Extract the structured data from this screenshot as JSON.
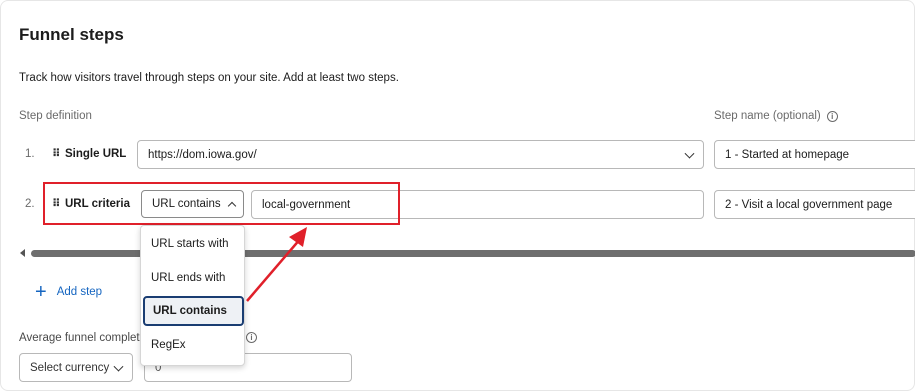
{
  "header": {
    "title": "Funnel steps",
    "description": "Track how visitors travel through steps on your site. Add at least two steps."
  },
  "columns": {
    "step_definition": "Step definition",
    "step_name": "Step name (optional)",
    "info_glyph": "i"
  },
  "rows": [
    {
      "number": "1.",
      "type": "Single URL",
      "url_value": "https://dom.iowa.gov/",
      "name_value": "1 - Started at homepage"
    },
    {
      "number": "2.",
      "type": "URL criteria",
      "criteria": "URL contains",
      "criteria_value": "local-government",
      "name_value": "2 - Visit a local government page"
    }
  ],
  "dropdown_menu": {
    "options": [
      "URL starts with",
      "URL ends with",
      "URL contains",
      "RegEx"
    ],
    "selected": "URL contains"
  },
  "add_step_label": "Add step",
  "average": {
    "label": "Average funnel complet",
    "currency_placeholder": "Select currency",
    "value": "0"
  },
  "annotation": {
    "color": "#e0202a"
  }
}
